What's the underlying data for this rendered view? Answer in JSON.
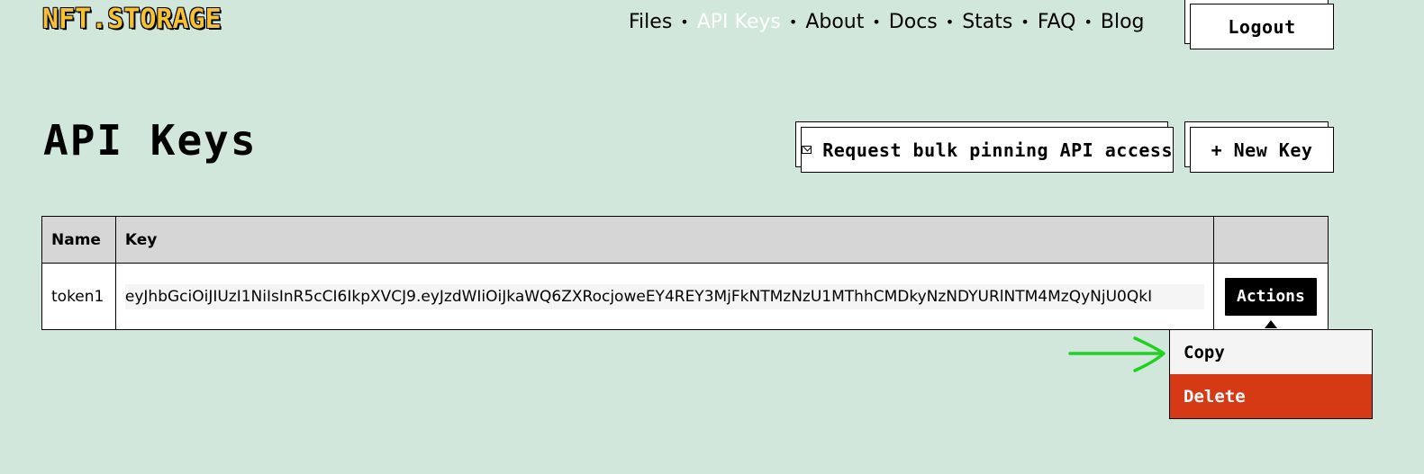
{
  "logo": {
    "text": "NFT.STORAGE"
  },
  "nav": {
    "items": [
      {
        "label": "Files",
        "active": false
      },
      {
        "label": "API Keys",
        "active": true
      },
      {
        "label": "About",
        "active": false
      },
      {
        "label": "Docs",
        "active": false
      },
      {
        "label": "Stats",
        "active": false
      },
      {
        "label": "FAQ",
        "active": false
      },
      {
        "label": "Blog",
        "active": false
      }
    ],
    "separator": "•"
  },
  "header": {
    "logout_label": "Logout"
  },
  "page": {
    "title": "API Keys",
    "bulk_button_label": "Request bulk pinning API access",
    "new_key_label": "+ New Key"
  },
  "table": {
    "columns": [
      "Name",
      "Key",
      ""
    ],
    "rows": [
      {
        "name": "token1",
        "key": "eyJhbGciOiJIUzI1NiIsInR5cCI6IkpXVCJ9.eyJzdWIiOiJkaWQ6ZXRocjoweEY4REY3MjFkNTMzNzU1MThhCMDkyNzNDYURlNTM4MzQyNjU0QkI",
        "actions_label": "Actions"
      }
    ]
  },
  "dropdown": {
    "copy_label": "Copy",
    "delete_label": "Delete"
  },
  "colors": {
    "background": "#d2e7dc",
    "logo": "#f6c233",
    "nav_active": "#ffffff",
    "delete": "#d63a14",
    "annotation_arrow": "#22d022"
  }
}
